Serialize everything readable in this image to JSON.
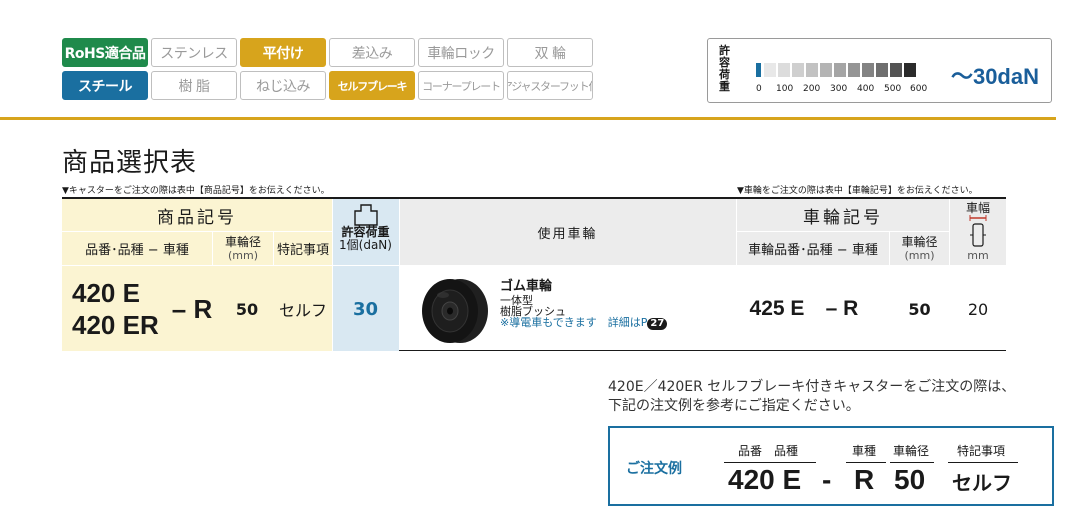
{
  "tags": {
    "row1": [
      "RoHS適合品",
      "ステンレス",
      "平付け",
      "差込み",
      "車輪ロック",
      "双 輪"
    ],
    "row2": [
      "スチール",
      "樹 脂",
      "ねじ込み",
      "セルフブレーキ",
      "コーナープレート",
      "アジャスターフット付"
    ]
  },
  "load": {
    "vertical_label": "許容荷重",
    "ticks": [
      "0",
      "100",
      "200",
      "300",
      "400",
      "500",
      "600"
    ],
    "value_text": "〜30daN"
  },
  "section_title": "商品選択表",
  "notes": {
    "left": "▼キャスターをご注文の際は表中【商品記号】をお伝えください。",
    "right": "▼車輪をご注文の際は表中【車輪記号】をお伝えください。"
  },
  "table": {
    "headers": {
      "product_code": "商品記号",
      "part_type": "品番･品種 − 車種",
      "wheel_dia": "車輪径",
      "wheel_dia_unit": "(mm)",
      "special": "特記事項",
      "load_l1": "許容荷重",
      "load_l2": "1個(daN)",
      "wheel_used": "使用車輪",
      "wheel_code": "車輪記号",
      "wheel_part_type": "車輪品番･品種 − 車種",
      "wheel_width": "車幅",
      "wheel_width_unit": "mm"
    },
    "row": {
      "part1": "420 E",
      "part2": "420 ER",
      "type": "– R",
      "dia": "50",
      "special": "セルフ",
      "load": "30",
      "wheel_title": "ゴム車輪",
      "wheel_l1": "一体型",
      "wheel_l2": "樹脂ブッシュ",
      "wheel_note": "※導電車もできます　詳細はP",
      "wheel_page": "27",
      "wheel_part": "425 E",
      "wheel_type": "– R",
      "wheel_dia": "50",
      "width": "20"
    }
  },
  "description": {
    "line1": "420E／420ER セルフブレーキ付きキャスターをご注文の際は、",
    "line2": "下記の注文例を参考にご指定ください。"
  },
  "order_example": {
    "label": "ご注文例",
    "h_part": "品番　品種",
    "h_type": "車種",
    "h_dia": "車輪径",
    "h_special": "特記事項",
    "part": "420 E",
    "dash": "-",
    "type": "R",
    "dia": "50",
    "special": "セルフ"
  }
}
